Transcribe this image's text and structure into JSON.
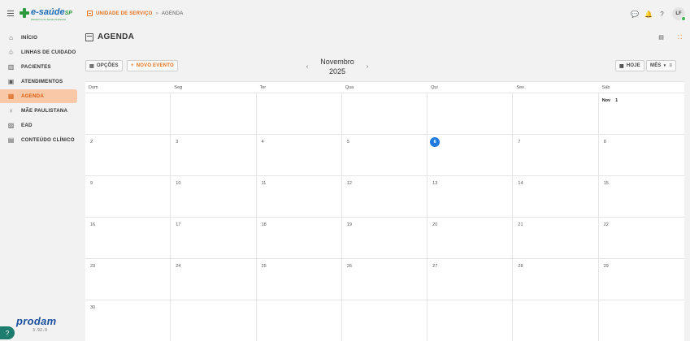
{
  "header": {
    "logo": "e-saúde",
    "logo_sp": "SP",
    "logo_sub": "Plataforma de Saúde Paulistana",
    "breadcrumb_main": "UNIDADE DE SERVIÇO",
    "breadcrumb_sep": "»",
    "breadcrumb_sub": "AGENDA",
    "user_initials": "LF"
  },
  "sidebar": {
    "items": [
      {
        "label": "INÍCIO",
        "icon": "home-icon"
      },
      {
        "label": "LINHAS DE CUIDADO",
        "icon": "care-lines-icon"
      },
      {
        "label": "PACIENTES",
        "icon": "patients-icon"
      },
      {
        "label": "ATENDIMENTOS",
        "icon": "clipboard-icon"
      },
      {
        "label": "AGENDA",
        "icon": "calendar-icon",
        "active": true
      },
      {
        "label": "MÃE PAULISTANA",
        "icon": "mother-icon"
      },
      {
        "label": "EAD",
        "icon": "ead-icon"
      },
      {
        "label": "CONTEÚDO CLÍNICO",
        "icon": "book-icon"
      }
    ],
    "brand": "prodam",
    "version": "3.92.0"
  },
  "page": {
    "title": "AGENDA"
  },
  "toolbar": {
    "options_label": "OPÇÕES",
    "new_event_label": "NOVO EVENTO",
    "month": "Novembro",
    "year": "2025",
    "prev": "‹",
    "next": "›",
    "today_label": "HOJE",
    "view_label": "MÊS"
  },
  "calendar": {
    "weekdays": [
      "Dom",
      "Seg",
      "Ter",
      "Qua",
      "Qui",
      "Sex",
      "Sáb"
    ],
    "month_abbr": "Nov",
    "first_weekday": 6,
    "days_in_month": 30,
    "today": 6,
    "colors": {
      "today": "#1f7ae0",
      "accent": "#e8711a",
      "active_nav": "#f9c8a6"
    }
  }
}
